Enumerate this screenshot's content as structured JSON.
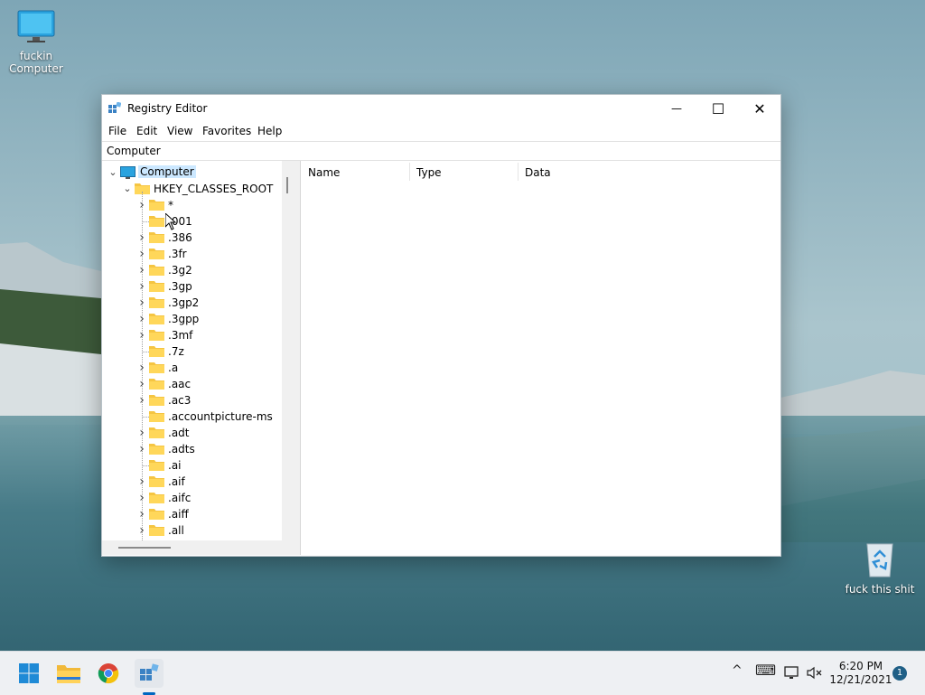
{
  "desktop": {
    "icons": [
      {
        "label": "fuckin Computer",
        "icon": "monitor-icon"
      },
      {
        "label": "fuck this shit",
        "icon": "recycle-bin-icon"
      }
    ]
  },
  "window": {
    "title": "Registry Editor",
    "controls": {
      "minimize": "—",
      "maximize": "☐",
      "close": "✕"
    },
    "menu": [
      "File",
      "Edit",
      "View",
      "Favorites",
      "Help"
    ],
    "address": "Computer",
    "tree": {
      "root": "Computer",
      "hive": "HKEY_CLASSES_ROOT",
      "keys": [
        {
          "name": "*",
          "expandable": true
        },
        {
          "name": ".001",
          "expandable": false
        },
        {
          "name": ".386",
          "expandable": true
        },
        {
          "name": ".3fr",
          "expandable": true
        },
        {
          "name": ".3g2",
          "expandable": true
        },
        {
          "name": ".3gp",
          "expandable": true
        },
        {
          "name": ".3gp2",
          "expandable": true
        },
        {
          "name": ".3gpp",
          "expandable": true
        },
        {
          "name": ".3mf",
          "expandable": true
        },
        {
          "name": ".7z",
          "expandable": false
        },
        {
          "name": ".a",
          "expandable": true
        },
        {
          "name": ".aac",
          "expandable": true
        },
        {
          "name": ".ac3",
          "expandable": true
        },
        {
          "name": ".accountpicture-ms",
          "expandable": false
        },
        {
          "name": ".adt",
          "expandable": true
        },
        {
          "name": ".adts",
          "expandable": true
        },
        {
          "name": ".ai",
          "expandable": false
        },
        {
          "name": ".aif",
          "expandable": true
        },
        {
          "name": ".aifc",
          "expandable": true
        },
        {
          "name": ".aiff",
          "expandable": true
        },
        {
          "name": ".all",
          "expandable": true
        }
      ]
    },
    "columns": [
      "Name",
      "Type",
      "Data"
    ]
  },
  "taskbar": {
    "apps": [
      "start-icon",
      "file-explorer-icon",
      "chrome-icon",
      "registry-editor-icon"
    ],
    "tray": {
      "chevron": "^",
      "keyboard": "⌨"
    },
    "time": "6:20 PM",
    "date": "12/21/2021",
    "notification_count": "1"
  },
  "colors": {
    "accent": "#0067c0",
    "folder": "#f5c542",
    "selection": "#cce8ff"
  }
}
